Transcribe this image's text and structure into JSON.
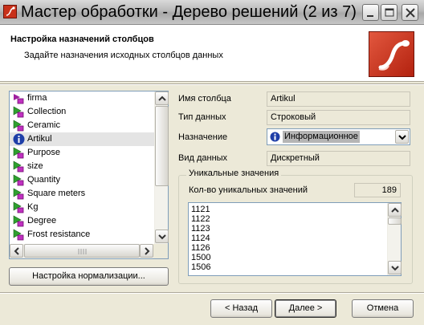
{
  "window": {
    "title": "Мастер обработки - Дерево решений (2 из 7)"
  },
  "header": {
    "title": "Настройка назначений столбцов",
    "subtitle": "Задайте назначения исходных столбцов данных"
  },
  "columns": {
    "items": [
      {
        "label": "firma",
        "icon": "purple-input-icon"
      },
      {
        "label": "Collection",
        "icon": "green-purple-input-icon"
      },
      {
        "label": "Ceramic",
        "icon": "green-purple-input-icon"
      },
      {
        "label": "Artikul",
        "icon": "info-icon",
        "selected": true
      },
      {
        "label": "Purpose",
        "icon": "green-purple-input-icon"
      },
      {
        "label": "size",
        "icon": "green-purple-input-icon"
      },
      {
        "label": "Quantity",
        "icon": "green-purple-input-icon"
      },
      {
        "label": "Square meters",
        "icon": "green-purple-input-icon"
      },
      {
        "label": "Kg",
        "icon": "green-purple-input-icon"
      },
      {
        "label": "Degree",
        "icon": "green-purple-input-icon"
      },
      {
        "label": "Frost resistance",
        "icon": "green-purple-input-icon"
      }
    ],
    "normalize_button": "Настройка нормализации..."
  },
  "props": {
    "name_label": "Имя столбца",
    "name_value": "Artikul",
    "type_label": "Тип данных",
    "type_value": "Строковый",
    "purpose_label": "Назначение",
    "purpose_value": "Информационное",
    "kind_label": "Вид данных",
    "kind_value": "Дискретный"
  },
  "unique": {
    "group_title": "Уникальные значения",
    "count_label": "Кол-во уникальных значений",
    "count_value": "189",
    "values": [
      "1121",
      "1122",
      "1123",
      "1124",
      "1126",
      "1500",
      "1506"
    ]
  },
  "buttons": {
    "back": "< Назад",
    "next": "Далее >",
    "cancel": "Отмена"
  },
  "colors": {
    "window_bg": "#ece9d8",
    "logo_red": "#c8311a",
    "selection_gray": "#b5b5b5",
    "info_blue": "#1f3fa8"
  }
}
